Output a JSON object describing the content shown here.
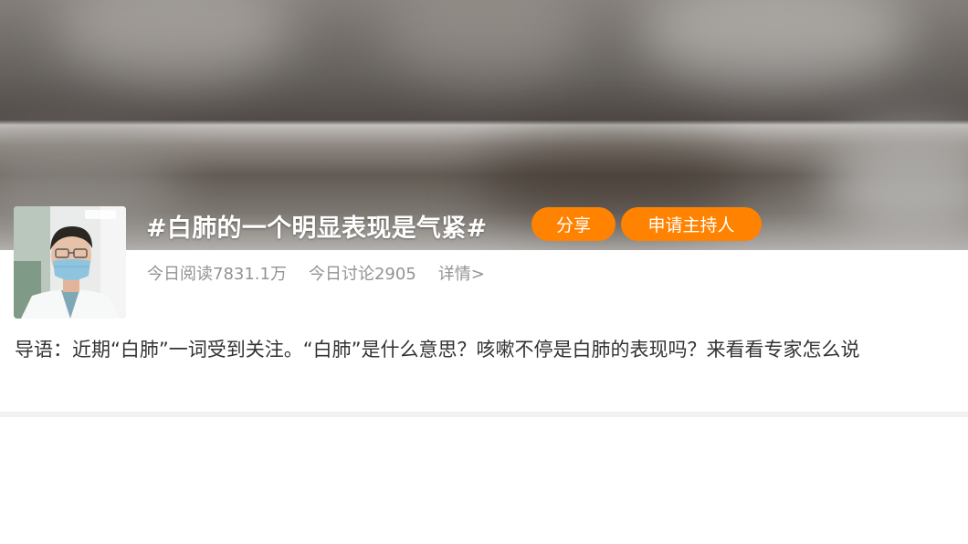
{
  "topic": {
    "title": "#白肺的一个明显表现是气紧#",
    "share_label": "分享",
    "apply_host_label": "申请主持人"
  },
  "stats": {
    "reads": "今日阅读7831.1万",
    "discussions": "今日讨论2905",
    "details_link": "详情>"
  },
  "guide": {
    "text": "导语：近期“白肺”一词受到关注。“白肺”是什么意思？咳嗽不停是白肺的表现吗？来看看专家怎么说"
  },
  "colors": {
    "accent": "#ff8200",
    "stat_text": "#939393",
    "body_text": "#333333"
  },
  "icons": {
    "avatar": "doctor-portrait-image"
  }
}
